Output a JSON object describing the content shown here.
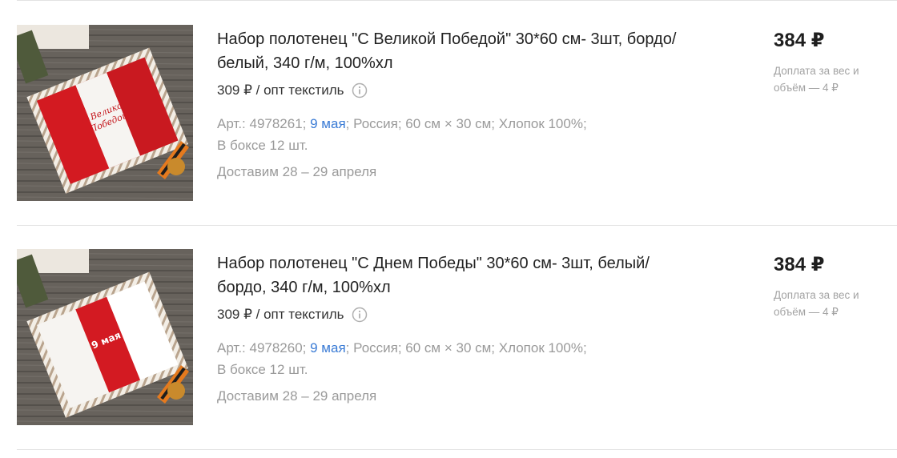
{
  "products": [
    {
      "title": "Набор полотенец \"С Великой Победой\" 30*60 см- 3шт, бордо/белый, 340 г/м, 100%хл",
      "wholesale": "309 ₽ / опт текстиль",
      "art": "Арт.: 4978261; ",
      "date_link": "9 мая",
      "specs_rest": "; Россия; 60 см × 30 см; Хлопок 100%;",
      "box": "В боксе 12 шт.",
      "delivery": "Доставим 28 – 29 апреля",
      "price": "384 ₽",
      "surcharge": "Доплата за вес и объём — 4 ₽",
      "image_lettering": "С Великой Победой"
    },
    {
      "title": "Набор полотенец \"С Днем Победы\" 30*60 см- 3шт, белый/бордо, 340 г/м, 100%хл",
      "wholesale": "309 ₽ / опт текстиль",
      "art": "Арт.: 4978260; ",
      "date_link": "9 мая",
      "specs_rest": "; Россия; 60 см × 30 см; Хлопок 100%;",
      "box": "В боксе 12 шт.",
      "delivery": "Доставим 28 – 29 апреля",
      "price": "384 ₽",
      "surcharge": "Доплата за вес и объём — 4 ₽",
      "image_lettering": "9 мая"
    }
  ],
  "colors": {
    "accent_link": "#3a7bd5",
    "muted_text": "#9a9a9a",
    "towel_red": "#d31a22",
    "wood": "#6b6660"
  },
  "icons": {
    "info": "info-circle-icon"
  }
}
